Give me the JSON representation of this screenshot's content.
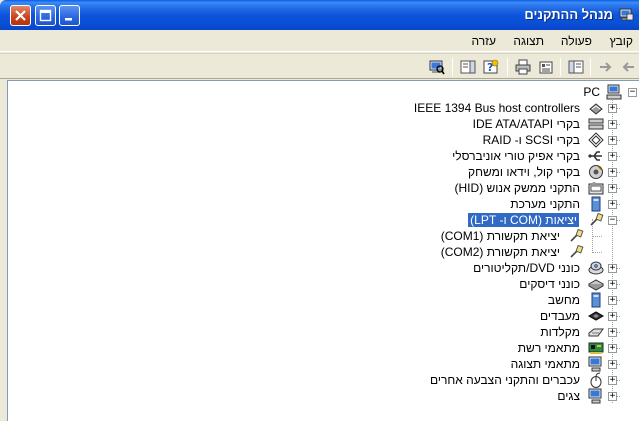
{
  "window": {
    "title": "מנהל ההתקנים"
  },
  "menubar": {
    "items": [
      "קובץ",
      "פעולה",
      "תצוגה",
      "עזרה"
    ]
  },
  "toolbar": {
    "buttons": [
      "back-icon",
      "forward-icon",
      "properties-icon",
      "print-icon",
      "help-icon",
      "view-icon",
      "scan-hardware-icon"
    ]
  },
  "tree": {
    "root": "PC",
    "categories": [
      {
        "label": "IEEE 1394 Bus host controllers",
        "icon": "firewire-icon",
        "expanded": false
      },
      {
        "label": "בקרי IDE ATA/ATAPI",
        "icon": "ide-controller-icon",
        "expanded": false
      },
      {
        "label": "בקרי SCSI ו- RAID",
        "icon": "scsi-icon",
        "expanded": false
      },
      {
        "label": "בקרי אפיק טורי אוניברסלי",
        "icon": "usb-icon",
        "expanded": false
      },
      {
        "label": "בקרי קול, וידאו ומשחק",
        "icon": "sound-icon",
        "expanded": false
      },
      {
        "label": "התקני ממשק אנוש (HID)",
        "icon": "hid-icon",
        "expanded": false
      },
      {
        "label": "התקני מערכת",
        "icon": "system-device-icon",
        "expanded": false
      },
      {
        "label": "יציאות (COM ו- LPT)",
        "icon": "port-icon",
        "expanded": true,
        "selected": true,
        "children": [
          "יציאת תקשורת (COM1)",
          "יציאת תקשורת (COM2)"
        ]
      },
      {
        "label": "כונני DVD/תקליטורים",
        "icon": "dvd-icon",
        "expanded": false
      },
      {
        "label": "כונני דיסקים",
        "icon": "disk-icon",
        "expanded": false
      },
      {
        "label": "מחשב",
        "icon": "computer-icon",
        "expanded": false
      },
      {
        "label": "מעבדים",
        "icon": "processor-icon",
        "expanded": false
      },
      {
        "label": "מקלדות",
        "icon": "keyboard-icon",
        "expanded": false
      },
      {
        "label": "מתאמי רשת",
        "icon": "network-adapter-icon",
        "expanded": false
      },
      {
        "label": "מתאמי תצוגה",
        "icon": "display-adapter-icon",
        "expanded": false
      },
      {
        "label": "עכברים והתקני הצבעה אחרים",
        "icon": "mouse-icon",
        "expanded": false
      },
      {
        "label": "צגים",
        "icon": "monitor-icon",
        "expanded": false
      }
    ]
  },
  "colors": {
    "titlebar": "#0a4fd6",
    "selection": "#316ac5",
    "close": "#c9421a"
  }
}
